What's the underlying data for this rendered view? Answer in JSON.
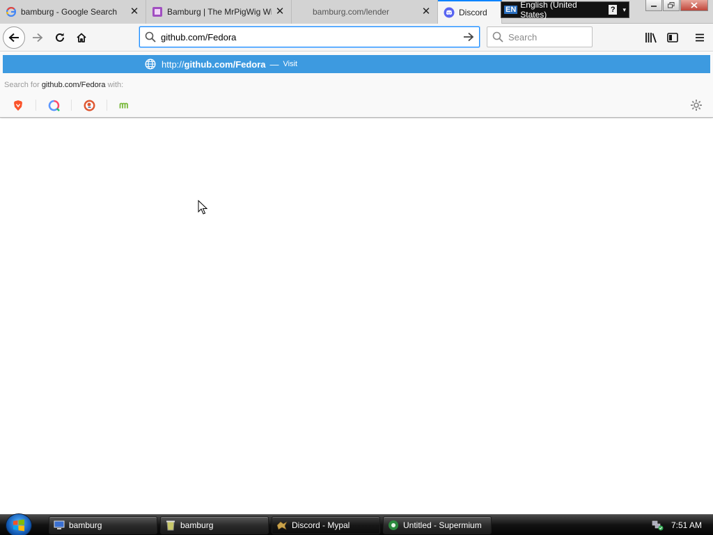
{
  "tabs": [
    {
      "title": "bamburg - Google Search",
      "favicon": "google-g-icon",
      "close": "✕"
    },
    {
      "title": "Bamburg | The MrPigWig Wiki",
      "favicon": "wiki-icon",
      "close": "✕"
    },
    {
      "title": "bamburg.com/lender",
      "favicon": "none",
      "close": "✕"
    },
    {
      "title": "Discord",
      "favicon": "discord-icon",
      "close": "",
      "active": true
    }
  ],
  "language_bar": {
    "code": "EN",
    "label": "English (United States)",
    "help": "?"
  },
  "navbar": {
    "url_value": "github.com/Fedora",
    "search_placeholder": "Search"
  },
  "dropdown": {
    "suggestion": {
      "protocol": "http://",
      "host": "github.com/Fedora",
      "separator": "—",
      "action": "Visit"
    },
    "search_for_prefix": "Search for",
    "search_for_query": "github.com/Fedora",
    "search_for_suffix": "with:",
    "engines": [
      "brave-icon",
      "qwant-icon",
      "duckduckgo-icon",
      "mojeek-icon"
    ]
  },
  "taskbar": {
    "items": [
      {
        "label": "bamburg",
        "icon": "computer-icon"
      },
      {
        "label": "bamburg",
        "icon": "recycle-bin-icon"
      },
      {
        "label": "Discord - Mypal",
        "icon": "mypal-icon",
        "active": true
      },
      {
        "label": "Untitled - Supermium",
        "icon": "supermium-icon"
      }
    ],
    "clock": "7:51 AM"
  },
  "colors": {
    "accent": "#0a84ff",
    "suggestion_bg": "#3d9ae0",
    "discord": "#5865f2"
  }
}
